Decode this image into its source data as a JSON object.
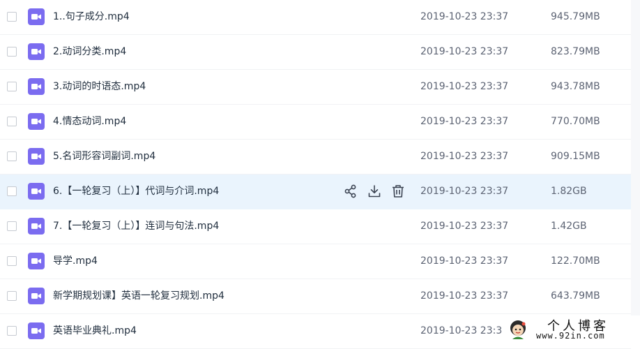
{
  "colors": {
    "file_icon": "#7b6cf0",
    "hover_row": "#eaf4fd",
    "name_text": "#1f2d3d",
    "meta_text": "#5c6373"
  },
  "row_actions": {
    "icons": [
      "share-icon",
      "download-icon",
      "delete-icon"
    ]
  },
  "files": [
    {
      "name": "1..句子成分.mp4",
      "date": "2019-10-23 23:37",
      "size": "945.79MB",
      "icon": "video-file-icon"
    },
    {
      "name": "2.动词分类.mp4",
      "date": "2019-10-23 23:37",
      "size": "823.79MB",
      "icon": "video-file-icon"
    },
    {
      "name": "3.动词的时语态.mp4",
      "date": "2019-10-23 23:37",
      "size": "943.78MB",
      "icon": "video-file-icon"
    },
    {
      "name": "4.情态动词.mp4",
      "date": "2019-10-23 23:37",
      "size": "770.70MB",
      "icon": "video-file-icon"
    },
    {
      "name": "5.名词形容词副词.mp4",
      "date": "2019-10-23 23:37",
      "size": "909.15MB",
      "icon": "video-file-icon"
    },
    {
      "name": "6.【一轮复习（上）】代词与介词.mp4",
      "date": "2019-10-23 23:37",
      "size": "1.82GB",
      "icon": "video-file-icon",
      "hovered": true
    },
    {
      "name": "7.【一轮复习（上）】连词与句法.mp4",
      "date": "2019-10-23 23:37",
      "size": "1.42GB",
      "icon": "video-file-icon"
    },
    {
      "name": "导学.mp4",
      "date": "2019-10-23 23:37",
      "size": "122.70MB",
      "icon": "video-file-icon"
    },
    {
      "name": "新学期规划课】英语一轮复习规划.mp4",
      "date": "2019-10-23 23:37",
      "size": "643.79MB",
      "icon": "video-file-icon"
    },
    {
      "name": "英语毕业典礼.mp4",
      "date": "2019-10-23 23:3",
      "size": "",
      "icon": "video-file-icon"
    }
  ],
  "watermark": {
    "title": "个人博客",
    "url": "www.92in.com"
  }
}
